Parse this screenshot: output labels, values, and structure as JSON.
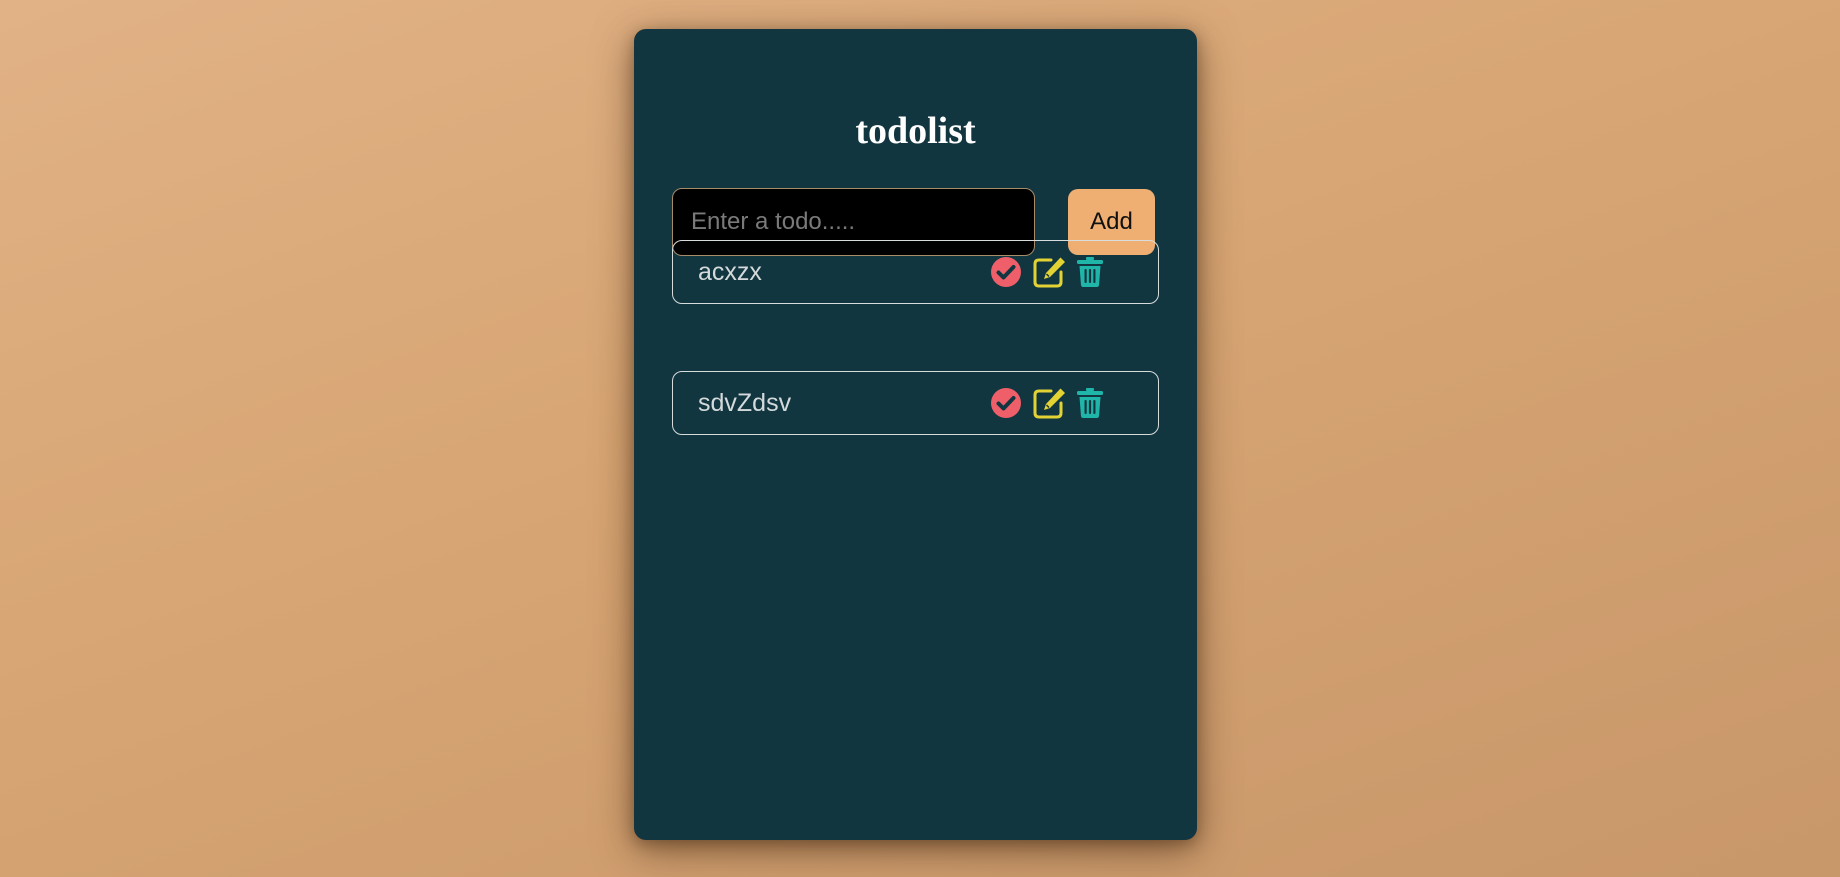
{
  "app": {
    "title": "todolist"
  },
  "form": {
    "input_placeholder": "Enter a todo.....",
    "input_value": "",
    "add_label": "Add"
  },
  "todos": [
    {
      "text": "acxzx"
    },
    {
      "text": "sdvZdsv"
    }
  ],
  "icons": {
    "complete": "check-circle-icon",
    "edit": "pencil-square-icon",
    "delete": "trash-icon"
  },
  "colors": {
    "page_background": "#d9a877",
    "card_background": "#123640",
    "add_button": "#efaf73",
    "complete_icon": "#ee5f6a",
    "edit_icon": "#e3d234",
    "delete_icon": "#1fb5a8"
  }
}
